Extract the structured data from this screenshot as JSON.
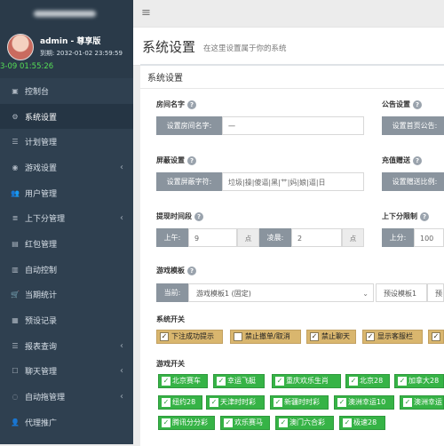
{
  "sidebar": {
    "user_name": "admin - 尊享版",
    "expire_text": "到期: 2032-01-02 23:59:59",
    "clock": "3-09 01:55:26",
    "items": [
      {
        "label": "控制台",
        "icon": "▣"
      },
      {
        "label": "系统设置",
        "icon": "⚙"
      },
      {
        "label": "计划管理",
        "icon": "☰"
      },
      {
        "label": "游戏设置",
        "icon": "◉",
        "chevron": "‹"
      },
      {
        "label": "用户管理",
        "icon": "👥"
      },
      {
        "label": "上下分管理",
        "icon": "≣",
        "chevron": "‹"
      },
      {
        "label": "红包管理",
        "icon": "▤"
      },
      {
        "label": "自动控制",
        "icon": "▥"
      },
      {
        "label": "当期统计",
        "icon": "🛒"
      },
      {
        "label": "预设记录",
        "icon": "▦"
      },
      {
        "label": "报表查询",
        "icon": "☰",
        "chevron": "‹"
      },
      {
        "label": "聊天管理",
        "icon": "☐",
        "chevron": "‹"
      },
      {
        "label": "自动拖管理",
        "icon": "◌",
        "chevron": "‹"
      },
      {
        "label": "代理推广",
        "icon": "👤"
      }
    ]
  },
  "topbar": {
    "menu_icon": "≡"
  },
  "header": {
    "title": "系统设置",
    "subtitle": "在这里设置属于你的系统"
  },
  "panel": {
    "title": "系统设置"
  },
  "room": {
    "label": "房间名字",
    "addon": "设置房间名字:",
    "value": "一"
  },
  "notice": {
    "label": "公告设置",
    "addon": "设置首页公告:"
  },
  "block": {
    "label": "屏蔽设置",
    "addon": "设置屏蔽字符:",
    "value": "垃圾|操|傻逼|黑|艹|妈|娘|逼|日"
  },
  "recharge": {
    "label": "充值赠送",
    "addon": "设置赠送比例:"
  },
  "withdraw_time": {
    "label": "提现时间段",
    "am_label": "上午:",
    "am_value": "9",
    "am_unit": "点",
    "pm_label": "凌晨:",
    "pm_value": "2",
    "pm_unit": "点"
  },
  "limit": {
    "label": "上下分限制",
    "addon": "上分:",
    "value": "100"
  },
  "template": {
    "label": "游戏模板",
    "current_label": "当前:",
    "current_value": "游戏模板1 (固定)",
    "caret": "⌄",
    "preset_label": "预设模板1",
    "preset2_label": "预"
  },
  "system_switch": {
    "label": "系统开关",
    "items": [
      "下注成功提示",
      "禁止撤单/取消",
      "禁止聊天",
      "显示客服栏",
      ""
    ],
    "checks": [
      "✓",
      "",
      "✓",
      "✓",
      "✓"
    ]
  },
  "game_switch": {
    "label": "游戏开关",
    "items": [
      "北京赛车",
      "幸运飞艇",
      "重庆欢乐生肖",
      "北京28",
      "加拿大28",
      "纽约28",
      "天津时时彩",
      "新疆时时彩",
      "澳洲幸运10",
      "澳洲幸运",
      "腾讯分分彩",
      "欢乐赛马",
      "澳门六合彩",
      "极速28"
    ]
  },
  "help_icon": "?",
  "colors": {
    "sidebar": "#2f4050",
    "clock": "#55dd55",
    "switch": "#d9b66e",
    "game": "#36b346"
  }
}
